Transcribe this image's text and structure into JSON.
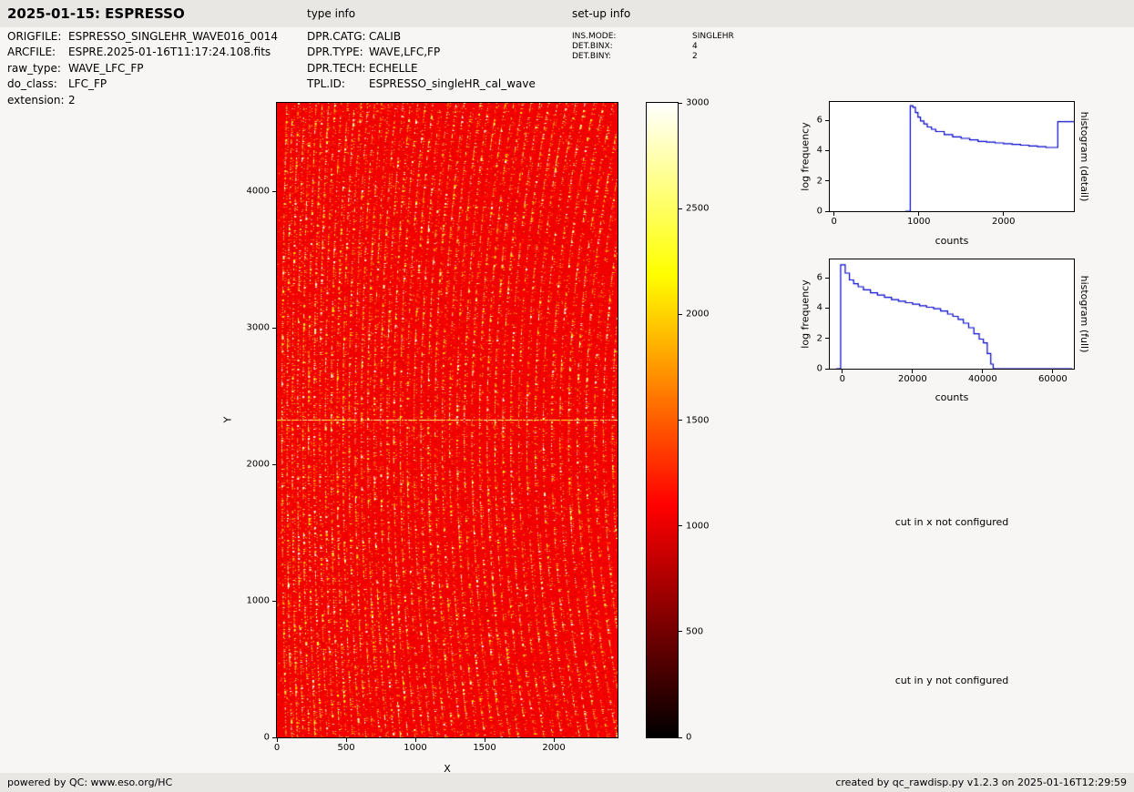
{
  "header": {
    "title": "2025-01-15: ESPRESSO",
    "type_info_label": "type info",
    "setup_info_label": "set-up info"
  },
  "metadata": {
    "left": [
      {
        "label": "ORIGFILE:",
        "value": "ESPRESSO_SINGLEHR_WAVE016_0014"
      },
      {
        "label": "ARCFILE:",
        "value": "ESPRE.2025-01-16T11:17:24.108.fits"
      },
      {
        "label": "raw_type:",
        "value": "WAVE_LFC_FP"
      },
      {
        "label": "do_class:",
        "value": "LFC_FP"
      },
      {
        "label": "extension:",
        "value": "2"
      }
    ],
    "middle": [
      {
        "label": "DPR.CATG:",
        "value": "CALIB"
      },
      {
        "label": "DPR.TYPE:",
        "value": "WAVE,LFC,FP"
      },
      {
        "label": "DPR.TECH:",
        "value": "ECHELLE"
      },
      {
        "label": "TPL.ID:",
        "value": "ESPRESSO_singleHR_cal_wave"
      }
    ],
    "right": [
      {
        "label": "INS.MODE:",
        "value": "SINGLEHR"
      },
      {
        "label": "DET.BINX:",
        "value": "4"
      },
      {
        "label": "DET.BINY:",
        "value": "2"
      }
    ]
  },
  "messages": {
    "cut_x": "cut in x not configured",
    "cut_y": "cut in y not configured"
  },
  "footer": {
    "left": "powered by QC: www.eso.org/HC",
    "right": "created by qc_rawdisp.py v1.2.3 on 2025-01-16T12:29:59"
  },
  "chart_data": [
    {
      "type": "heatmap",
      "title": "",
      "xlabel": "X",
      "ylabel": "Y",
      "xlim": [
        0,
        2460
      ],
      "ylim": [
        0,
        4650
      ],
      "xticks": [
        0,
        500,
        1000,
        1500,
        2000
      ],
      "yticks": [
        0,
        1000,
        2000,
        3000,
        4000
      ],
      "colorbar": {
        "min": 0,
        "max": 3000,
        "ticks": [
          0,
          500,
          1000,
          1500,
          2000,
          2500,
          3000
        ],
        "colormap": "hot"
      },
      "description": "Raw ESPRESSO WAVE,LFC,FP calibration frame: red background near 1000 counts covered by dense, slightly curved vertical echelle-order traces of bright yellow/white emission dots; spacing widens toward the right; bright horizontal detector-gap line near Y=2330"
    },
    {
      "type": "line",
      "style": "step",
      "title": "histogram (detail)",
      "xlabel": "counts",
      "ylabel": "log frequency",
      "color": "#0000cc",
      "xlim": [
        -50,
        2830
      ],
      "ylim": [
        0,
        7.2
      ],
      "xticks": [
        0,
        1000,
        2000
      ],
      "yticks": [
        0,
        2,
        4,
        6
      ],
      "x": [
        840,
        900,
        930,
        960,
        990,
        1020,
        1060,
        1100,
        1150,
        1200,
        1300,
        1400,
        1500,
        1600,
        1700,
        1800,
        1900,
        2000,
        2100,
        2200,
        2300,
        2400,
        2500,
        2600,
        2640,
        2830
      ],
      "y": [
        0,
        6.95,
        6.85,
        6.5,
        6.2,
        5.95,
        5.75,
        5.55,
        5.4,
        5.25,
        5.05,
        4.9,
        4.8,
        4.7,
        4.6,
        4.55,
        4.5,
        4.45,
        4.4,
        4.35,
        4.3,
        4.25,
        4.2,
        4.2,
        5.9,
        5.9
      ]
    },
    {
      "type": "line",
      "style": "step",
      "title": "histogram (full)",
      "xlabel": "counts",
      "ylabel": "log frequency",
      "color": "#0000cc",
      "xlim": [
        -3600,
        66000
      ],
      "ylim": [
        0,
        7.2
      ],
      "xticks": [
        0,
        20000,
        40000,
        60000
      ],
      "yticks": [
        0,
        2,
        4,
        6
      ],
      "x": [
        -1800,
        -500,
        800,
        2000,
        3200,
        4500,
        6000,
        8000,
        10000,
        12000,
        14000,
        16000,
        18000,
        20000,
        22000,
        24000,
        26000,
        28000,
        30000,
        31500,
        33000,
        34500,
        36000,
        37500,
        39000,
        40200,
        41300,
        42300,
        43000,
        65500
      ],
      "y": [
        0,
        6.85,
        6.3,
        5.85,
        5.6,
        5.4,
        5.2,
        5.0,
        4.85,
        4.7,
        4.55,
        4.45,
        4.35,
        4.25,
        4.15,
        4.05,
        3.95,
        3.8,
        3.6,
        3.45,
        3.25,
        3.0,
        2.7,
        2.3,
        1.95,
        1.7,
        1.0,
        0.3,
        0,
        0
      ]
    }
  ]
}
